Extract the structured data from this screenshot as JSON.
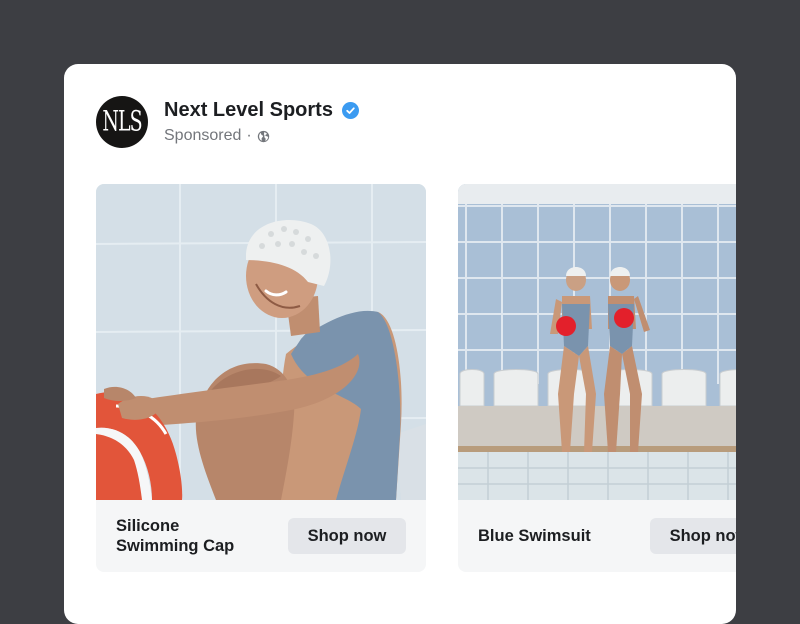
{
  "post": {
    "avatar_text": "NLS",
    "page_name": "Next Level Sports",
    "sponsored_label": "Sponsored",
    "separator": "·",
    "verified_icon": "verified-badge-icon",
    "audience_icon": "globe-icon"
  },
  "carousel": {
    "items": [
      {
        "title": "Silicone\nSwimming Cap",
        "cta": "Shop now",
        "image": "swimmer-with-lifebuoy"
      },
      {
        "title": "Blue Swimsuit",
        "cta": "Shop now",
        "image": "two-swimmers-with-balls"
      }
    ]
  },
  "colors": {
    "background": "#3d3e43",
    "card": "#ffffff",
    "verified": "#3b9bf1",
    "button": "#e4e6ea",
    "footer": "#f5f6f7",
    "swimsuit": "#7a93ad",
    "lifebuoy": "#e2553a",
    "ball": "#e3202b"
  }
}
